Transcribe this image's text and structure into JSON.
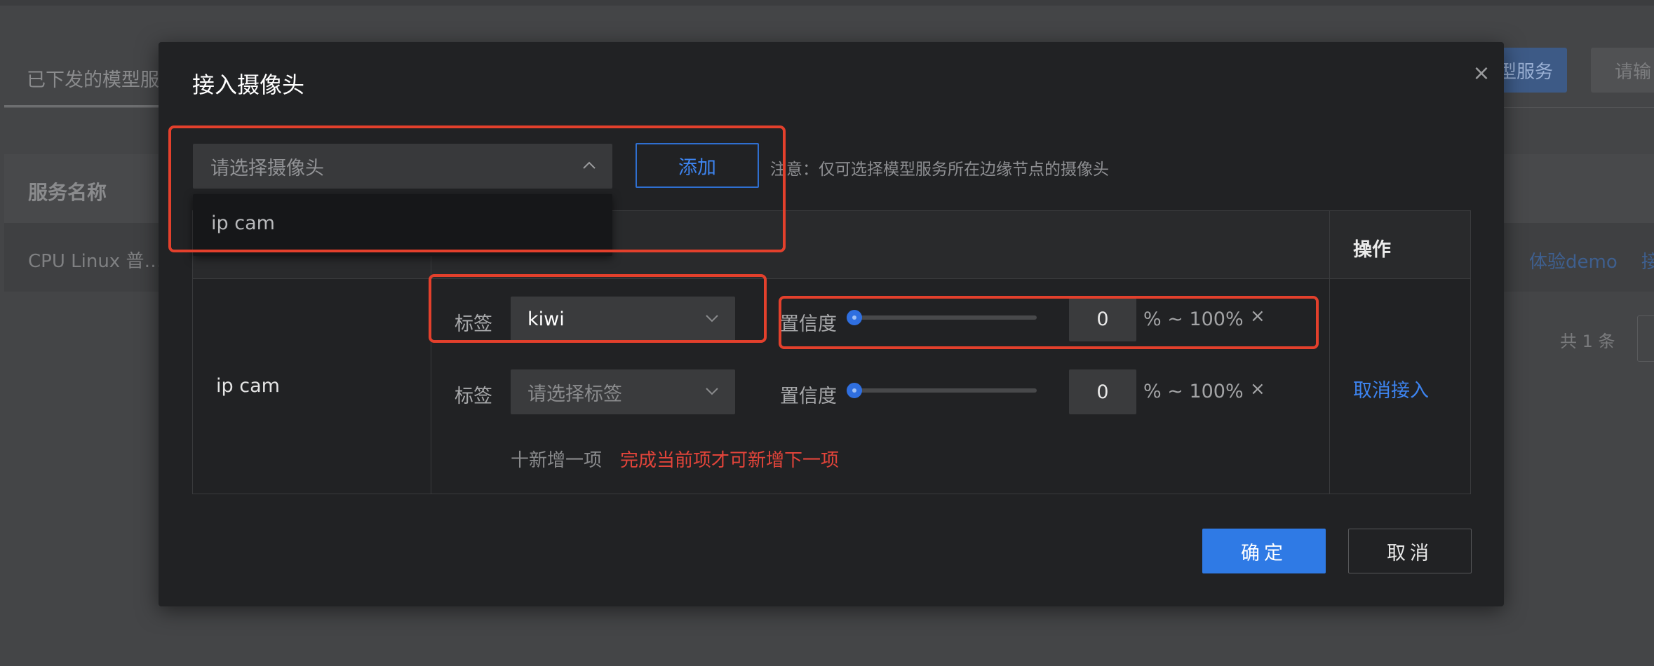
{
  "background": {
    "tab_label": "已下发的模型服",
    "primary_button_label": "型服务",
    "search_placeholder": "请输",
    "table_header": "服务名称",
    "row_name": "CPU Linux 普…",
    "row_link_demo": "体验demo",
    "row_link_other": "接",
    "pager_total": "共 1 条"
  },
  "modal": {
    "title": "接入摄像头",
    "close_icon": "×",
    "camera_select_placeholder": "请选择摄像头",
    "camera_options": [
      "ip cam"
    ],
    "add_button_label": "添加",
    "note": "注意：仅可选择模型服务所在边缘节点的摄像头",
    "table": {
      "op_header": "操作",
      "camera_name": "ip cam",
      "rules": [
        {
          "label": "标签",
          "tag_value": "kiwi",
          "tag_placeholder": "",
          "confidence_label": "置信度",
          "confidence_min": "0",
          "range_suffix": "% ~ 100%",
          "remove_icon": "×"
        },
        {
          "label": "标签",
          "tag_value": "",
          "tag_placeholder": "请选择标签",
          "confidence_label": "置信度",
          "confidence_min": "0",
          "range_suffix": "% ~ 100%",
          "remove_icon": "×"
        }
      ],
      "add_item_label": "十新增一项",
      "add_item_warning": "完成当前项才可新增下一项",
      "cancel_access_label": "取消接入"
    },
    "ok_label": "确定",
    "cancel_label": "取消"
  },
  "colors": {
    "accent": "#2f7ae5",
    "warning": "#e2443a",
    "annotation": "#e3402c"
  }
}
